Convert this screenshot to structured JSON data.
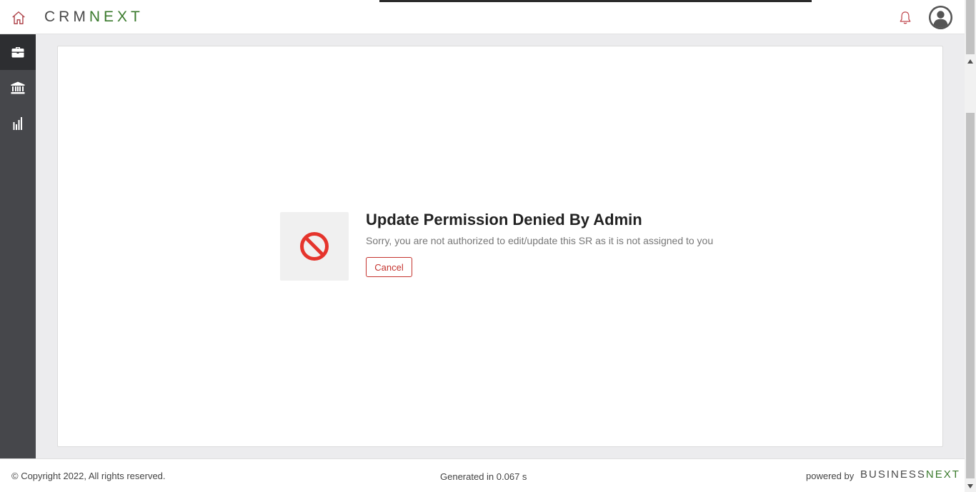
{
  "header": {
    "logo_part1": "CRM",
    "logo_part2": "NEXT",
    "icons": {
      "home": "home-icon",
      "bell": "bell-icon",
      "avatar": "user-avatar-icon"
    },
    "colors": {
      "home_icon": "#b14a50",
      "brand_green": "#3a7a2c"
    }
  },
  "sidenav": {
    "items": [
      {
        "icon": "briefcase-icon",
        "active": true
      },
      {
        "icon": "bank-icon",
        "active": false
      },
      {
        "icon": "bar-chart-icon",
        "active": false
      }
    ]
  },
  "main": {
    "title": "Update Permission Denied By Admin",
    "message": "Sorry, you are not authorized to edit/update this SR as it is not assigned to you",
    "cancel_label": "Cancel",
    "icon": "prohibited-icon",
    "accent_color": "#e5342c"
  },
  "footer": {
    "copyright": "© Copyright 2022, All rights reserved.",
    "generated": "Generated in 0.067 s",
    "powered_by": "powered by",
    "brand_part1": "BUSINESS",
    "brand_part2": "NEXT"
  }
}
